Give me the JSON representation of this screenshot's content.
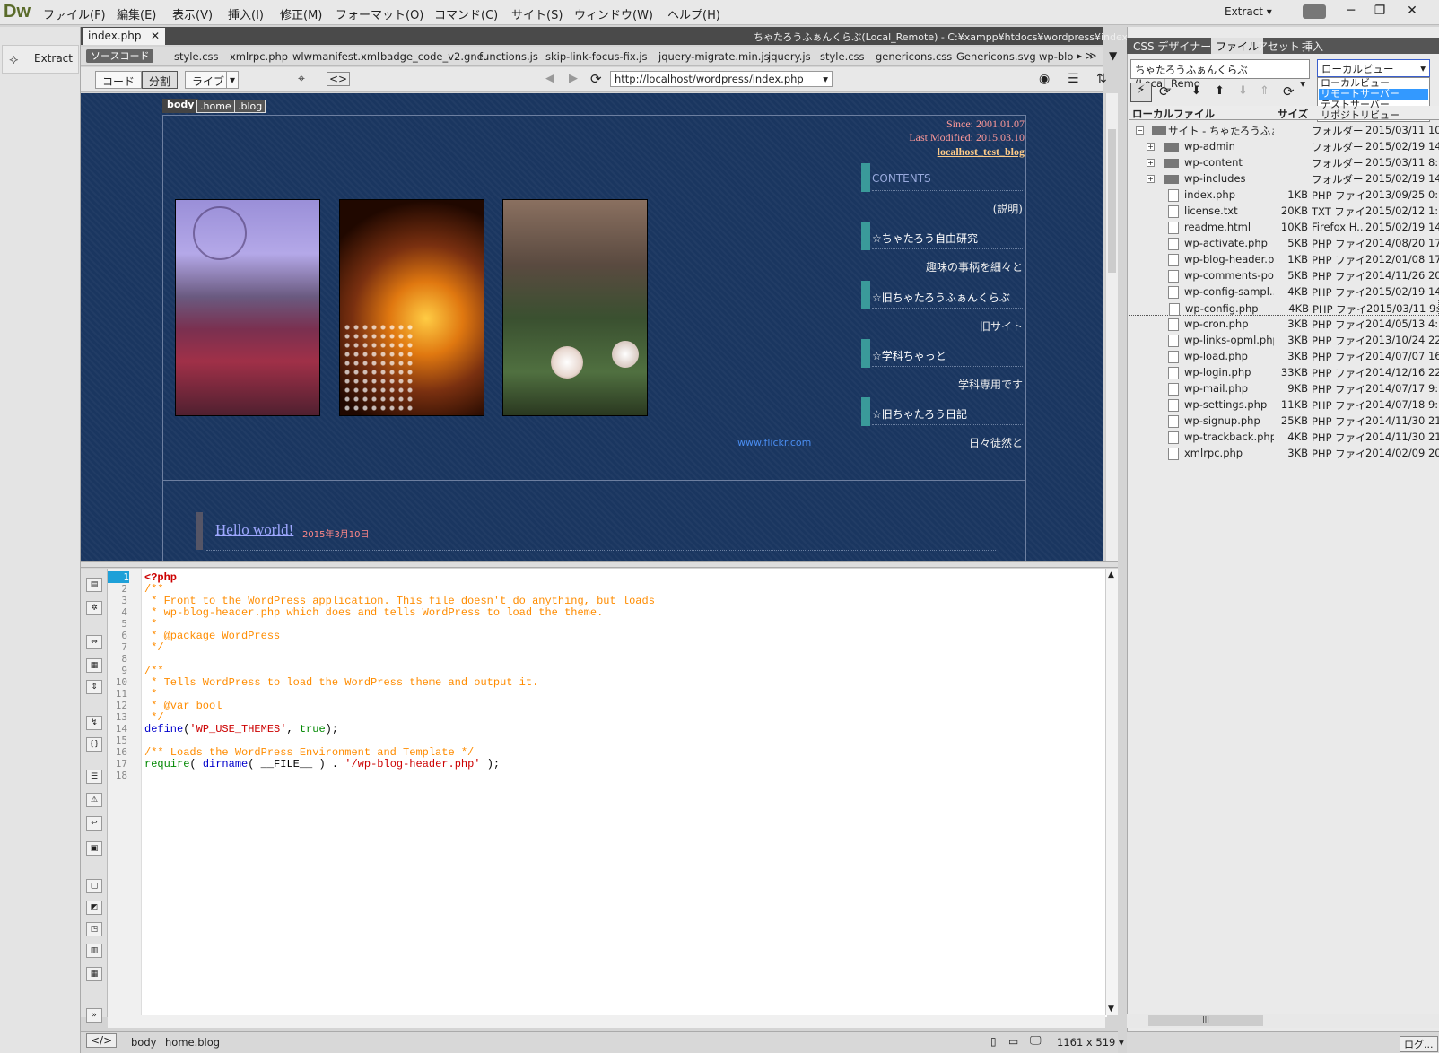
{
  "app": {
    "logo": "Dw",
    "workspace": "Extract"
  },
  "menu": [
    "ファイル(F)",
    "編集(E)",
    "表示(V)",
    "挿入(I)",
    "修正(M)",
    "フォーマット(O)",
    "コマンド(C)",
    "サイト(S)",
    "ウィンドウ(W)",
    "ヘルプ(H)"
  ],
  "left_panel": {
    "extract_label": "Extract"
  },
  "doc": {
    "tab": "index.php",
    "path": "ちゃたろうふぁんくらぶ(Local_Remote) - C:¥xampp¥htdocs¥wordpress¥index.php"
  },
  "related": {
    "source": "ソースコード",
    "files": [
      "style.css",
      "xmlrpc.php",
      "wlwmanifest.xml",
      "badge_code_v2.gne",
      "functions.js",
      "skip-link-focus-fix.js",
      "jquery-migrate.min.js",
      "jquery.js",
      "style.css",
      "genericons.css",
      "Genericons.svg",
      "wp-blo"
    ]
  },
  "toolbar": {
    "code": "コード",
    "split": "分割",
    "live": "ライブ",
    "url": "http://localhost/wordpress/index.php"
  },
  "design": {
    "tag_body": "body",
    "tag_home": ".home",
    "tag_blog": ".blog",
    "since": "Since: 2001.01.07",
    "modified": "Last Modified: 2015.03.10",
    "blogname": "localhost_test_blog",
    "nav": [
      {
        "title": "CONTENTS",
        "desc": "(説明)"
      },
      {
        "title": "☆ちゃたろう自由研究",
        "desc": "趣味の事柄を細々と"
      },
      {
        "title": "☆旧ちゃたろうふぁんくらぶ",
        "desc": "旧サイト"
      },
      {
        "title": "☆学科ちゃっと",
        "desc": "学科専用です"
      },
      {
        "title": "☆旧ちゃたろう日記",
        "desc": "日々徒然と"
      }
    ],
    "flickr": "www.flickr.com",
    "post_title": "Hello world!",
    "post_date": "2015年3月10日"
  },
  "code": {
    "lines": [
      [
        {
          "t": "<?php",
          "c": "php"
        }
      ],
      [
        {
          "t": "/**",
          "c": "cm"
        }
      ],
      [
        {
          "t": " * Front to the WordPress application. This file doesn't do anything, but loads",
          "c": "cm"
        }
      ],
      [
        {
          "t": " * wp-blog-header.php which does and tells WordPress to load the theme.",
          "c": "cm"
        }
      ],
      [
        {
          "t": " *",
          "c": "cm"
        }
      ],
      [
        {
          "t": " * @package WordPress",
          "c": "cm"
        }
      ],
      [
        {
          "t": " */",
          "c": "cm"
        }
      ],
      [],
      [
        {
          "t": "/**",
          "c": "cm"
        }
      ],
      [
        {
          "t": " * Tells WordPress to load the WordPress theme and output it.",
          "c": "cm"
        }
      ],
      [
        {
          "t": " *",
          "c": "cm"
        }
      ],
      [
        {
          "t": " * @var bool",
          "c": "cm"
        }
      ],
      [
        {
          "t": " */",
          "c": "cm"
        }
      ],
      [
        {
          "t": "define",
          "c": "kw"
        },
        {
          "t": "(",
          "c": "plain"
        },
        {
          "t": "'WP_USE_THEMES'",
          "c": "st"
        },
        {
          "t": ", ",
          "c": "plain"
        },
        {
          "t": "true",
          "c": "tr"
        },
        {
          "t": ");",
          "c": "plain"
        }
      ],
      [],
      [
        {
          "t": "/** Loads the WordPress Environment and Template */",
          "c": "cm"
        }
      ],
      [
        {
          "t": "require",
          "c": "tr"
        },
        {
          "t": "( ",
          "c": "plain"
        },
        {
          "t": "dirname",
          "c": "kw"
        },
        {
          "t": "( __FILE__ ) . ",
          "c": "plain"
        },
        {
          "t": "'/wp-blog-header.php'",
          "c": "st"
        },
        {
          "t": " );",
          "c": "plain"
        }
      ],
      []
    ]
  },
  "status": {
    "body": "body",
    "homeblog": "home.blog",
    "size": "1161 x 519"
  },
  "right": {
    "tabs": [
      "CSS デザイナー",
      "ファイル",
      "アセット",
      "挿入"
    ],
    "site": "ちゃたろうふぁんくらぶ(Local_Remo",
    "view": "ローカルビュー",
    "view_options": [
      "ローカルビュー",
      "リモートサーバー",
      "テストサーバー",
      "リポジトリビュー"
    ],
    "col_name": "ローカルファイル",
    "col_size": "サイズ",
    "files": [
      {
        "name": "サイト - ちゃたろうふぁ...",
        "size": "",
        "type": "フォルダー",
        "date": "2015/03/11 10",
        "kind": "root"
      },
      {
        "name": "wp-admin",
        "size": "",
        "type": "フォルダー",
        "date": "2015/02/19 14",
        "kind": "folder"
      },
      {
        "name": "wp-content",
        "size": "",
        "type": "フォルダー",
        "date": "2015/03/11 8:5",
        "kind": "folder"
      },
      {
        "name": "wp-includes",
        "size": "",
        "type": "フォルダー",
        "date": "2015/02/19 14",
        "kind": "folder"
      },
      {
        "name": "index.php",
        "size": "1KB",
        "type": "PHP ファイ...",
        "date": "2013/09/25 0:",
        "kind": "file"
      },
      {
        "name": "license.txt",
        "size": "20KB",
        "type": "TXT ファイ...",
        "date": "2015/02/12 1:",
        "kind": "file"
      },
      {
        "name": "readme.html",
        "size": "10KB",
        "type": "Firefox H...",
        "date": "2015/02/19 14",
        "kind": "file"
      },
      {
        "name": "wp-activate.php",
        "size": "5KB",
        "type": "PHP ファイ...",
        "date": "2014/08/20 17",
        "kind": "file"
      },
      {
        "name": "wp-blog-header.p...",
        "size": "1KB",
        "type": "PHP ファイ...",
        "date": "2012/01/08 17",
        "kind": "file"
      },
      {
        "name": "wp-comments-po...",
        "size": "5KB",
        "type": "PHP ファイ...",
        "date": "2014/11/26 20",
        "kind": "file"
      },
      {
        "name": "wp-config-sampl...",
        "size": "4KB",
        "type": "PHP ファイ...",
        "date": "2015/02/19 14",
        "kind": "file"
      },
      {
        "name": "wp-config.php",
        "size": "4KB",
        "type": "PHP ファイ...",
        "date": "2015/03/11 9:",
        "kind": "file"
      },
      {
        "name": "wp-cron.php",
        "size": "3KB",
        "type": "PHP ファイ...",
        "date": "2014/05/13 4:",
        "kind": "file"
      },
      {
        "name": "wp-links-opml.php",
        "size": "3KB",
        "type": "PHP ファイ...",
        "date": "2013/10/24 22",
        "kind": "file"
      },
      {
        "name": "wp-load.php",
        "size": "3KB",
        "type": "PHP ファイ...",
        "date": "2014/07/07 16",
        "kind": "file"
      },
      {
        "name": "wp-login.php",
        "size": "33KB",
        "type": "PHP ファイ...",
        "date": "2014/12/16 22",
        "kind": "file"
      },
      {
        "name": "wp-mail.php",
        "size": "9KB",
        "type": "PHP ファイ...",
        "date": "2014/07/17 9:",
        "kind": "file"
      },
      {
        "name": "wp-settings.php",
        "size": "11KB",
        "type": "PHP ファイ...",
        "date": "2014/07/18 9:",
        "kind": "file"
      },
      {
        "name": "wp-signup.php",
        "size": "25KB",
        "type": "PHP ファイ...",
        "date": "2014/11/30 21",
        "kind": "file"
      },
      {
        "name": "wp-trackback.php",
        "size": "4KB",
        "type": "PHP ファイ...",
        "date": "2014/11/30 21",
        "kind": "file"
      },
      {
        "name": "xmlrpc.php",
        "size": "3KB",
        "type": "PHP ファイ...",
        "date": "2014/02/09 20",
        "kind": "file"
      }
    ],
    "log": "ログ..."
  }
}
